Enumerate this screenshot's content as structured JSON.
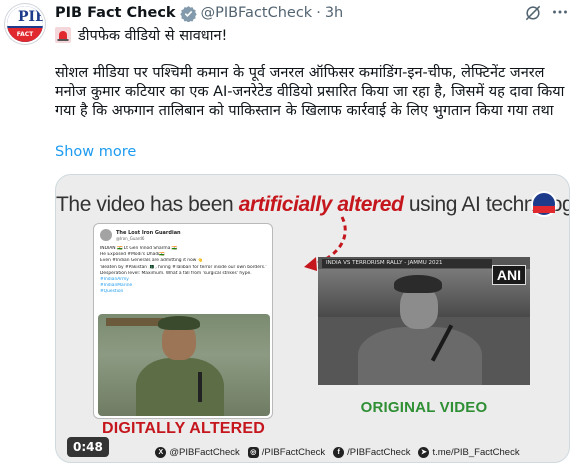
{
  "tweet": {
    "author_name": "PIB Fact Check",
    "author_handle": "@PIBFactCheck",
    "separator": "·",
    "time": "3h",
    "subject": "डीपफेक वीडियो से सावधान!",
    "body": "सोशल मीडिया पर पश्चिमी कमान के पूर्व जनरल ऑफिसर कमांडिंग-इन-चीफ, लेफ्टिनेंट जनरल मनोज कुमार कटियार का एक AI-जनरेटेड वीडियो प्रसारित किया जा रहा है, जिसमें यह दावा किया गया है कि अफगान तालिबान को पाकिस्तान के खिलाफ कार्रवाई के लिए भुगतान किया गया तथा",
    "show_more": "Show more",
    "avatar_logo_text": "PIB",
    "avatar_band_text": "FACT CHECK"
  },
  "media": {
    "title_before": "The video has been ",
    "title_highlight": "artificially altered",
    "title_after": " using AI technology!",
    "label_altered": "DIGITALLY ALTERED",
    "label_original": "ORIGINAL VIDEO",
    "ani_logo": "ANI",
    "duration": "0:48",
    "colors": {
      "altered_red": "#c4161c",
      "original_green": "#2f8f34",
      "link_blue": "#1d9bf0"
    },
    "inner_post": {
      "name": "The Lost Iron Guardian",
      "handle": "@Iron_Guard6",
      "lines": [
        "INDIAN 🇮🇳 Lt Gen Vinod Sharma 🇮🇳",
        "He Exposed #Modi's Dhadi🇮🇳",
        "Even #Indian Generals are admitting it now 👆",
        "'Beaten by #Pakistan 🇵🇰 , hiring #Taliban for terror inside our own borders.'",
        "Desperation level: Maximum. What a fall from 'surgical strikes' hype.",
        "#IndianArmy",
        "#IndianMarine",
        "#Question"
      ]
    },
    "original_banner": "INDIA VS TERRORISM RALLY - JAMMU 2021"
  },
  "footer": [
    {
      "icon": "twitter-x-icon",
      "text": "@PIBFactCheck"
    },
    {
      "icon": "instagram-icon",
      "text": "/PIBFactCheck"
    },
    {
      "icon": "facebook-icon",
      "text": "/PIBFactCheck"
    },
    {
      "icon": "telegram-icon",
      "text": "t.me/PIB_FactCheck"
    }
  ]
}
